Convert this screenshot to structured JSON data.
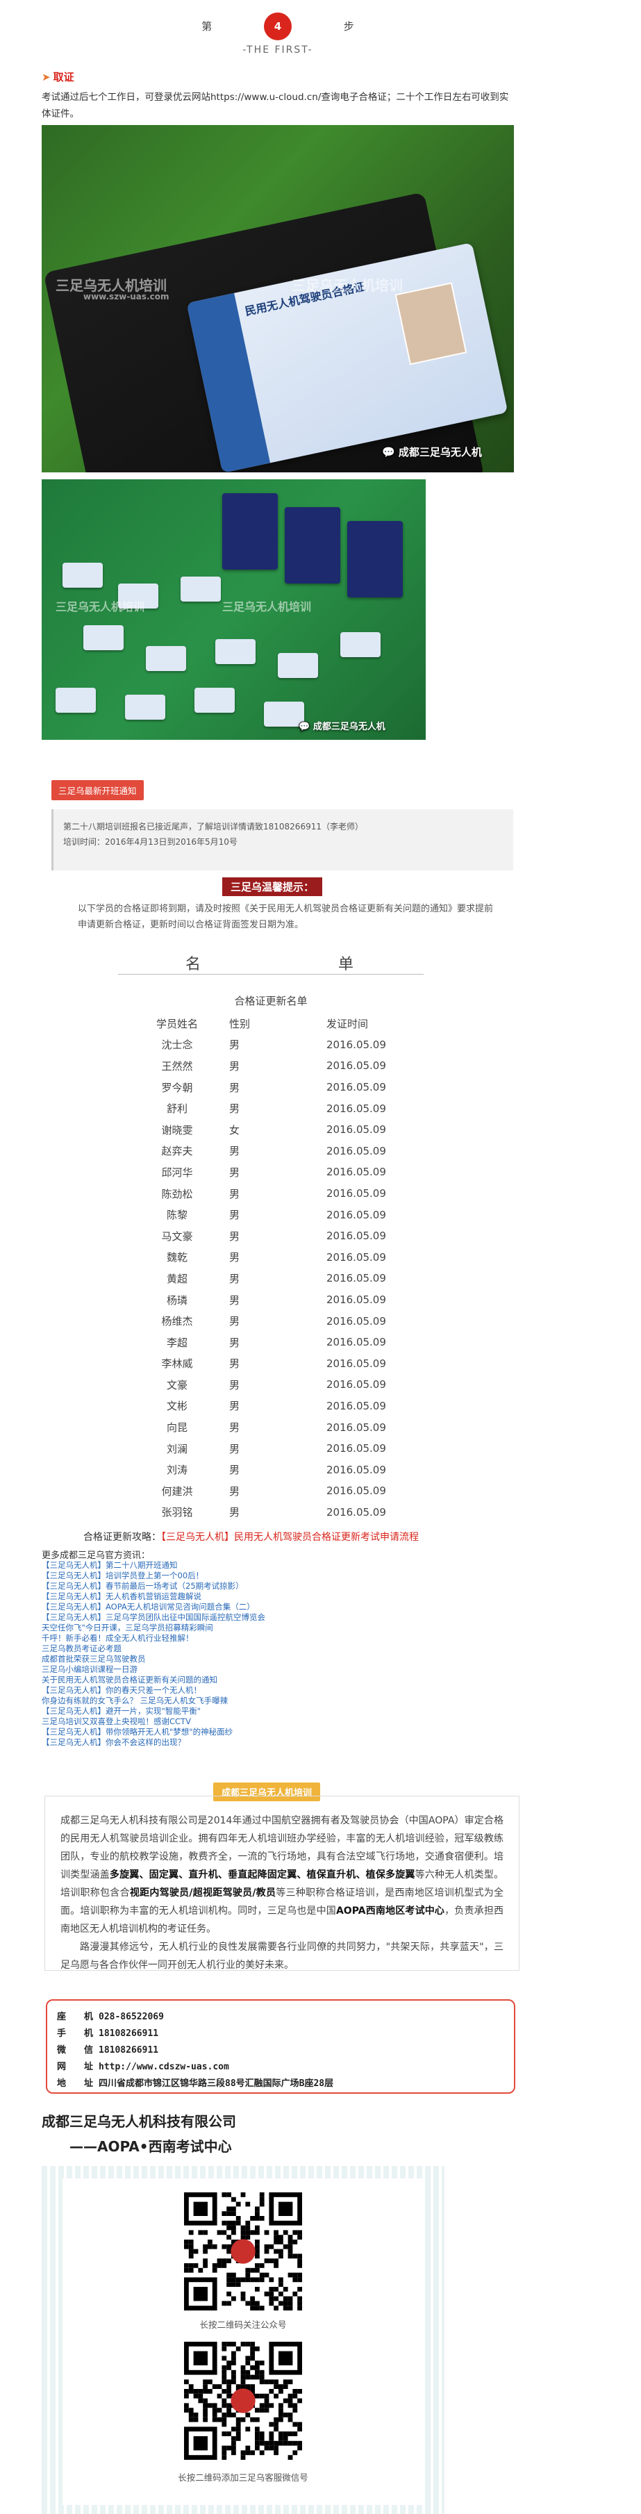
{
  "step": {
    "left_label": "第",
    "number": "4",
    "right_label": "步",
    "subtitle": "-THE FIRST-"
  },
  "section": {
    "title": "取证",
    "text": "考试通过后七个工作日，可登录优云网站https://www.u-cloud.cn/查询电子合格证；二十个工作日左右可收到实体证件。"
  },
  "photos": {
    "watermark": "三足乌无人机培训",
    "watermark_url": "www.szw-uas.com",
    "caption1": "成都三足乌无人机",
    "caption2": "成都三足乌无人机",
    "card_title": "民用无人机驾驶员合格证"
  },
  "notice": {
    "tag": "三足乌最新开班通知",
    "line1": "第二十八期培训班报名已接近尾声，了解培训详情请致18108266911（李老师）",
    "line2": "培训时间：2016年4月13日到2016年5月10号"
  },
  "tip": {
    "title": "三足乌温馨提示：",
    "text": "以下学员的合格证即将到期，请及时按照《关于民用无人机驾驶员合格证更新有关问题的通知》要求提前申请更新合格证，更新时间以合格证背面签发日期为准。"
  },
  "list": {
    "head_left": "名",
    "head_right": "单",
    "caption": "合格证更新名单",
    "columns": [
      "学员姓名",
      "性别",
      "发证时间"
    ],
    "rows": [
      [
        "沈士念",
        "男",
        "2016.05.09"
      ],
      [
        "王然然",
        "男",
        "2016.05.09"
      ],
      [
        "罗今朝",
        "男",
        "2016.05.09"
      ],
      [
        "舒利",
        "男",
        "2016.05.09"
      ],
      [
        "谢晓雯",
        "女",
        "2016.05.09"
      ],
      [
        "赵弈夫",
        "男",
        "2016.05.09"
      ],
      [
        "邱河华",
        "男",
        "2016.05.09"
      ],
      [
        "陈劲松",
        "男",
        "2016.05.09"
      ],
      [
        "陈黎",
        "男",
        "2016.05.09"
      ],
      [
        "马文豪",
        "男",
        "2016.05.09"
      ],
      [
        "魏乾",
        "男",
        "2016.05.09"
      ],
      [
        "黄超",
        "男",
        "2016.05.09"
      ],
      [
        "杨璘",
        "男",
        "2016.05.09"
      ],
      [
        "杨维杰",
        "男",
        "2016.05.09"
      ],
      [
        "李超",
        "男",
        "2016.05.09"
      ],
      [
        "李林威",
        "男",
        "2016.05.09"
      ],
      [
        "文豪",
        "男",
        "2016.05.09"
      ],
      [
        "文彬",
        "男",
        "2016.05.09"
      ],
      [
        "向昆",
        "男",
        "2016.05.09"
      ],
      [
        "刘澜",
        "男",
        "2016.05.09"
      ],
      [
        "刘涛",
        "男",
        "2016.05.09"
      ],
      [
        "何建洪",
        "男",
        "2016.05.09"
      ],
      [
        "张羽铭",
        "男",
        "2016.05.09"
      ]
    ]
  },
  "update": {
    "prefix": "合格证更新攻略：",
    "link": "【三足乌无人机】民用无人机驾驶员合格证更新考试申请流程"
  },
  "more": {
    "title": "更多成都三足乌官方资讯：",
    "links": [
      "【三足乌无人机】第二十八期开班通知",
      "【三足乌无人机】培训学员登上第一个00后！",
      "【三足乌无人机】春节前最后一场考试（25期考试掠影）",
      "【三足乌无人机】无人机香机营销运营趣解说",
      "【三足乌无人机】AOPA无人机培训常见咨询问题合集（二）",
      "【三足乌无人机】三足乌学员团队出征中国国际遥控航空博览会",
      "天空任你飞\"今日开课，三足乌学员招募精彩瞬间",
      "千呼！新手必看！成全无人机行业轻推解！",
      "三足乌教员考证必考题",
      "成都首批荣获三足乌驾驶教员",
      "三足乌小编培训课程一日游",
      "关于民用无人机驾驶员合格证更新有关问题的通知",
      "【三足乌无人机】你的春天只差一个无人机！",
      "你身边有练就的女飞手么？    三足乌无人机女飞手曝辣",
      "【三足乌无人机】避开一片，实现\"智能平衡\"",
      "三足乌培训又双喜登上央视啦！感谢CCTV",
      "【三足乌无人机】带你领略开无人机\"梦想\"的神秘面纱",
      "【三足乌无人机】你会不会这样的出现？"
    ]
  },
  "org": {
    "tag": "成都三足乌无人机培训",
    "text_a": "成都三足乌无人机科技有限公司是2014年通过中国航空器拥有者及驾驶员协会（中国AOPA）审定合格的民用无人机驾驶员培训企业。拥有四年无人机培训班办学经验，丰富的无人机培训经验，冠军级教练团队，专业的航校教学设施，教费齐全，一流的飞行场地，具有合法空域飞行场地，交通食宿便利。培训类型涵盖",
    "bold_a": "多旋翼、固定翼、直升机、垂直起降固定翼、植保直升机、植保多旋翼",
    "text_b": "等六种无人机类型。培训职称包含合",
    "bold_b": "视距内驾驶员/超视距驾驶员/教员",
    "text_c": "等三种职称合格证培训，是西南地区培训机型式为全面。培训职称为丰富的无人机培训机构。同时，三足乌也是中国",
    "bold_c": "AOPA西南地区考试中心",
    "text_d": "，负责承担西南地区无人机培训机构的考证任务。",
    "text_e": "路漫漫其修远兮，无人机行业的良性发展需要各行业同僚的共同努力，\"共架天际，共享蓝天\"，三足乌愿与各合作伙伴一同开创无人机行业的美好未来。"
  },
  "contact": {
    "rows": [
      {
        "k": "座　　机",
        "v": "028-86522069"
      },
      {
        "k": "手　　机",
        "v": "18108266911"
      },
      {
        "k": "微　　信",
        "v": "18108266911"
      },
      {
        "k": "网　　址",
        "v": "http://www.cdszw-uas.com"
      },
      {
        "k": "地　　址",
        "v": "四川省成都市锦江区锦华路三段88号汇融国际广场B座28层"
      }
    ]
  },
  "footer": {
    "company": "成都三足乌无人机科技有限公司",
    "exam": "——AOPA•西南考试中心",
    "qr1_caption": "长按二维码关注公众号",
    "qr2_caption": "长按二维码添加三足乌客服微信号"
  }
}
